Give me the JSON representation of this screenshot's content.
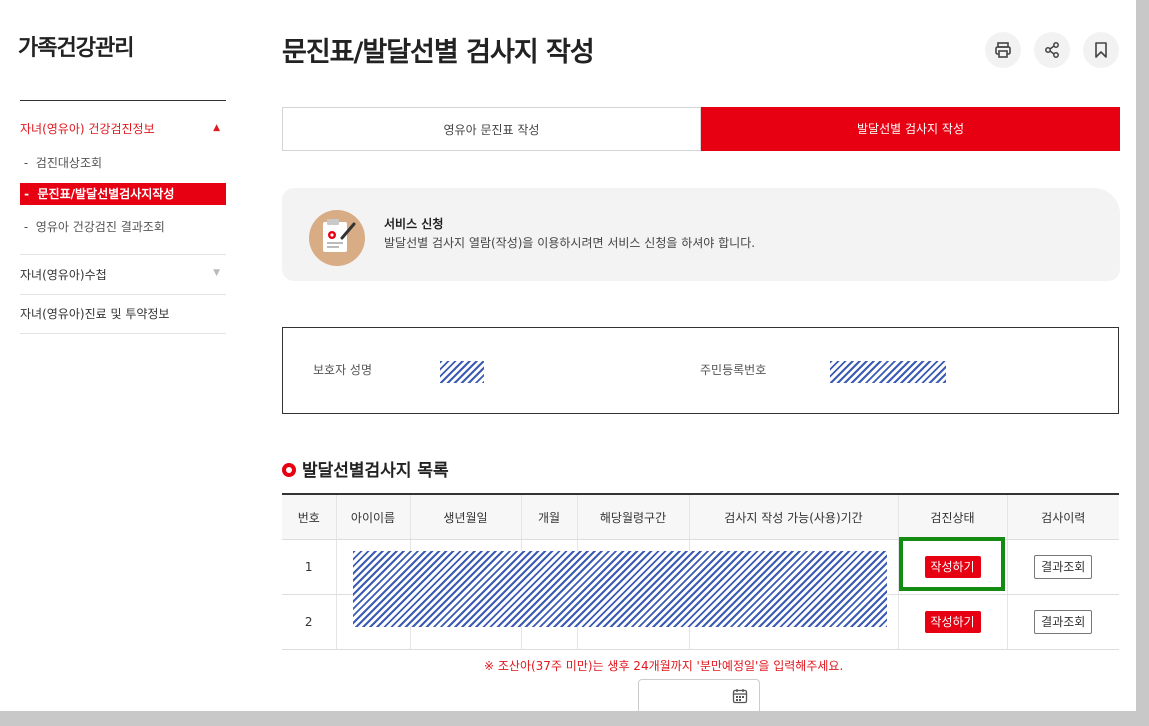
{
  "sidebar": {
    "title": "가족건강관리",
    "sections": [
      {
        "label": "자녀(영유아) 건강검진정보",
        "sub": [
          "검진대상조회",
          "문진표/발달선별검사지작성",
          "영유아 건강검진 결과조회"
        ]
      },
      {
        "label": "자녀(영유아)수첩"
      },
      {
        "label": "자녀(영유아)진료 및 투약정보"
      }
    ]
  },
  "header": {
    "title": "문진표/발달선별 검사지 작성",
    "icons": [
      "print-icon",
      "share-icon",
      "bookmark-icon"
    ]
  },
  "tabs": [
    {
      "label": "영유아 문진표 작성",
      "active": false
    },
    {
      "label": "발달선별 검사지 작성",
      "active": true
    }
  ],
  "notice": {
    "title": "서비스 신청",
    "desc": "발달선별 검사지 열람(작성)을 이용하시려면 서비스 신청을 하셔야 합니다."
  },
  "info": {
    "guardian_label": "보호자 성명",
    "rrn_label": "주민등록번호"
  },
  "list": {
    "title": "발달선별검사지 목록",
    "columns": [
      "번호",
      "아이이름",
      "생년월일",
      "개월",
      "해당월령구간",
      "검사지 작성 가능(사용)기간",
      "검진상태",
      "검사이력"
    ],
    "rows": [
      {
        "no": "1",
        "status": "작성하기",
        "history": "결과조회"
      },
      {
        "no": "2",
        "status": "작성하기",
        "history": "결과조회"
      }
    ]
  },
  "note": "※ 조산아(37주 미만)는 생후 24개월까지 '분만예정일'을 입력해주세요.",
  "colors": {
    "accent": "#e60012",
    "highlight": "#148c14",
    "redacted": "#3b5bb5"
  }
}
